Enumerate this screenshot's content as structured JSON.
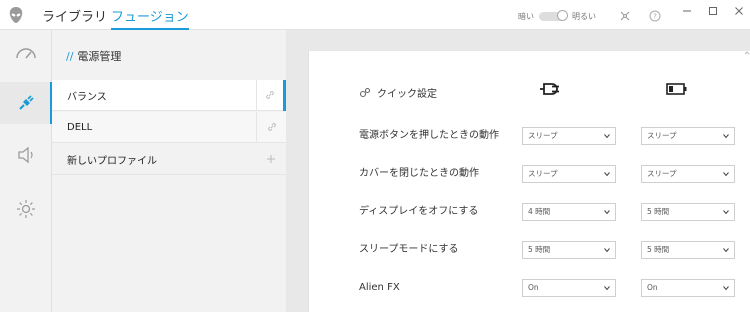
{
  "topbar": {
    "tabs": [
      {
        "label": "ライブラリ",
        "active": false
      },
      {
        "label": "フュージョン",
        "active": true
      }
    ],
    "theme": {
      "dark_label": "暗い",
      "light_label": "明るい"
    },
    "window_controls": [
      "minimize-icon",
      "maximize-icon",
      "close-icon"
    ]
  },
  "rail": {
    "items": [
      {
        "icon": "gauge-icon",
        "active": false
      },
      {
        "icon": "power-plug-icon",
        "active": true
      },
      {
        "icon": "speaker-icon",
        "active": false
      },
      {
        "icon": "brightness-icon",
        "active": false
      }
    ]
  },
  "profiles": {
    "title_prefix": "//",
    "title": "電源管理",
    "items": [
      {
        "label": "バランス",
        "selected": true,
        "action_icon": "link-icon"
      },
      {
        "label": "DELL",
        "selected": false,
        "action_icon": "link-icon"
      },
      {
        "label": "新しいプロファイル",
        "selected": false,
        "action_icon": "plus-icon"
      }
    ]
  },
  "settings": {
    "quick_label": "クイック設定",
    "columns": [
      {
        "icon": "ac-plug-icon"
      },
      {
        "icon": "battery-icon"
      }
    ],
    "rows": [
      {
        "label": "電源ボタンを押したときの動作",
        "ac": "スリープ",
        "battery": "スリープ"
      },
      {
        "label": "カバーを閉じたときの動作",
        "ac": "スリープ",
        "battery": "スリープ"
      },
      {
        "label": "ディスプレイをオフにする",
        "ac": "4 時間",
        "battery": "5 時間"
      },
      {
        "label": "スリープモードにする",
        "ac": "5 時間",
        "battery": "5 時間"
      },
      {
        "label": "Alien FX",
        "ac": "On",
        "battery": "On"
      }
    ]
  },
  "colors": {
    "accent": "#1a9bd7",
    "rail_bg": "#f2f2f2",
    "gutter_bg": "#e8e8e8"
  }
}
